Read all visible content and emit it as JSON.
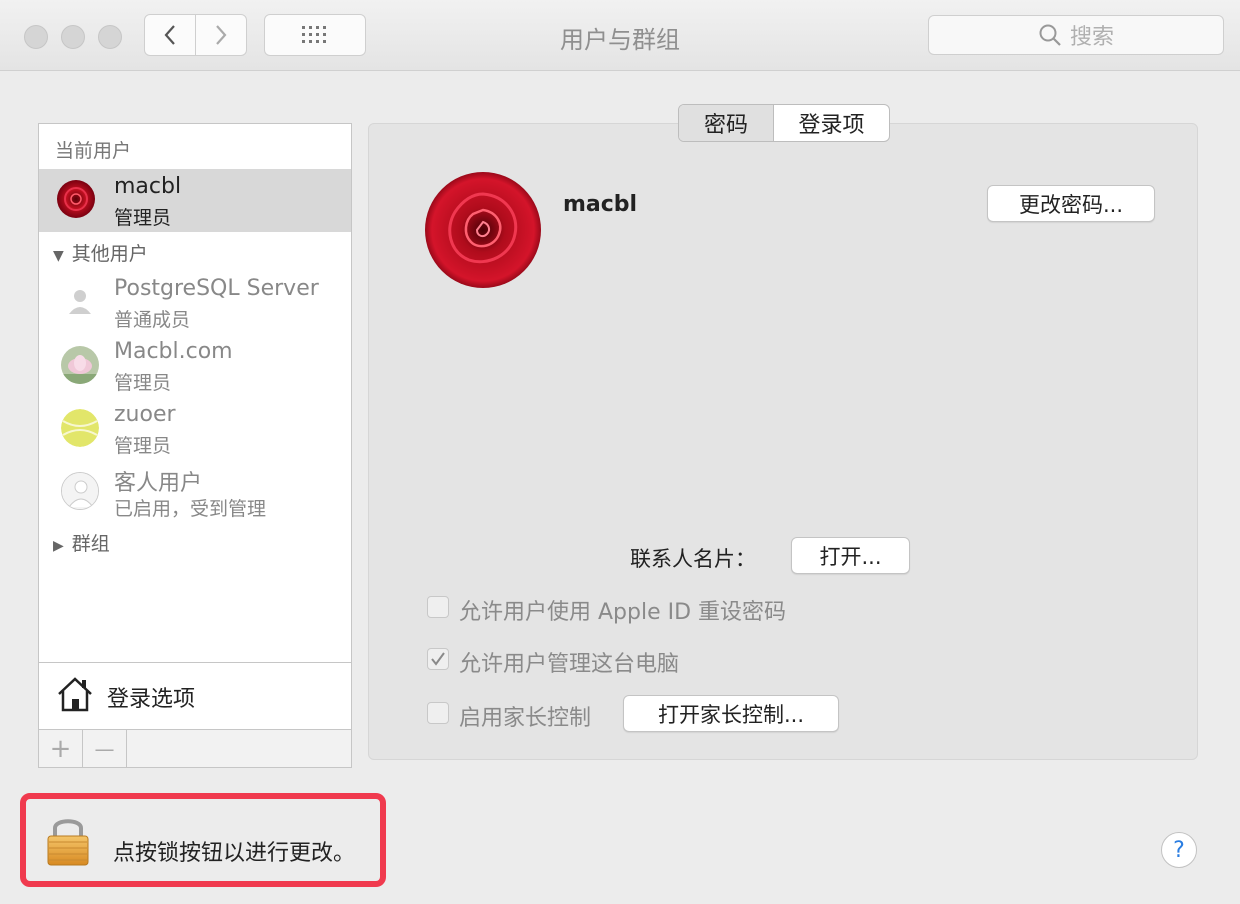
{
  "window": {
    "title": "用户与群组"
  },
  "search": {
    "placeholder": "搜索"
  },
  "sidebar": {
    "current_section": "当前用户",
    "current_user": {
      "name": "macbl",
      "role": "管理员"
    },
    "other_section": "其他用户",
    "other_users": [
      {
        "name": "PostgreSQL Server",
        "role": "普通成员",
        "avatar": "silhouette-icon"
      },
      {
        "name": "Macbl.com",
        "role": "管理员",
        "avatar": "lotus-icon"
      },
      {
        "name": "zuoer",
        "role": "管理员",
        "avatar": "tennis-ball-icon"
      },
      {
        "name": "客人用户",
        "role": "已启用，受到管理",
        "avatar": "guest-icon"
      }
    ],
    "groups_section": "群组",
    "login_options": "登录选项",
    "add": "+",
    "remove": "—"
  },
  "tabs": {
    "password": "密码",
    "login_items": "登录项",
    "active": "password"
  },
  "panel": {
    "user_name": "macbl",
    "change_password": "更改密码...",
    "contact_card_label": "联系人名片：",
    "open_button": "打开...",
    "allow_appleid_reset": "允许用户使用 Apple ID 重设密码",
    "allow_admin": "允许用户管理这台电脑",
    "enable_parental": "启用家长控制",
    "open_parental": "打开家长控制...",
    "checkbox_states": {
      "allow_appleid_reset": false,
      "allow_admin": true,
      "enable_parental": false
    }
  },
  "footer": {
    "lock_text": "点按锁按钮以进行更改。",
    "help": "?",
    "highlight_color": "#f03a4e"
  }
}
